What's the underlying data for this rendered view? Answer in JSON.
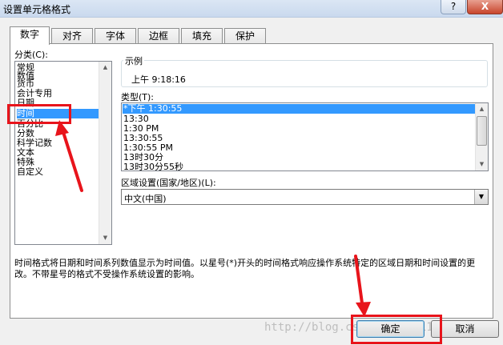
{
  "window": {
    "title": "设置单元格格式",
    "help_label": "?",
    "close_label": "X"
  },
  "tabs": [
    {
      "label": "数字",
      "active": true
    },
    {
      "label": "对齐",
      "active": false
    },
    {
      "label": "字体",
      "active": false
    },
    {
      "label": "边框",
      "active": false
    },
    {
      "label": "填充",
      "active": false
    },
    {
      "label": "保护",
      "active": false
    }
  ],
  "category": {
    "label": "分类(C):",
    "items": [
      "常规",
      "数值",
      "货币",
      "会计专用",
      "日期",
      "时间",
      "百分比",
      "分数",
      "科学记数",
      "文本",
      "特殊",
      "自定义"
    ],
    "selected": "时间"
  },
  "sample": {
    "label": "示例",
    "value": "上午 9:18:16"
  },
  "type": {
    "label": "类型(T):",
    "items": [
      "*下午 1:30:55",
      "13:30",
      "1:30 PM",
      "13:30:55",
      "1:30:55 PM",
      "13时30分",
      "13时30分55秒"
    ],
    "selected": "*下午 1:30:55"
  },
  "locale": {
    "label": "区域设置(国家/地区)(L):",
    "value": "中文(中国)"
  },
  "description": "时间格式将日期和时间系列数值显示为时间值。以星号(*)开头的时间格式响应操作系统特定的区域日期和时间设置的更改。不带星号的格式不受操作系统设置的影响。",
  "buttons": {
    "ok": "确定",
    "cancel": "取消"
  },
  "watermark": "http://blog.csdn.net/u01122308",
  "colors": {
    "selection": "#3399ff",
    "annotation": "#e8141b"
  }
}
